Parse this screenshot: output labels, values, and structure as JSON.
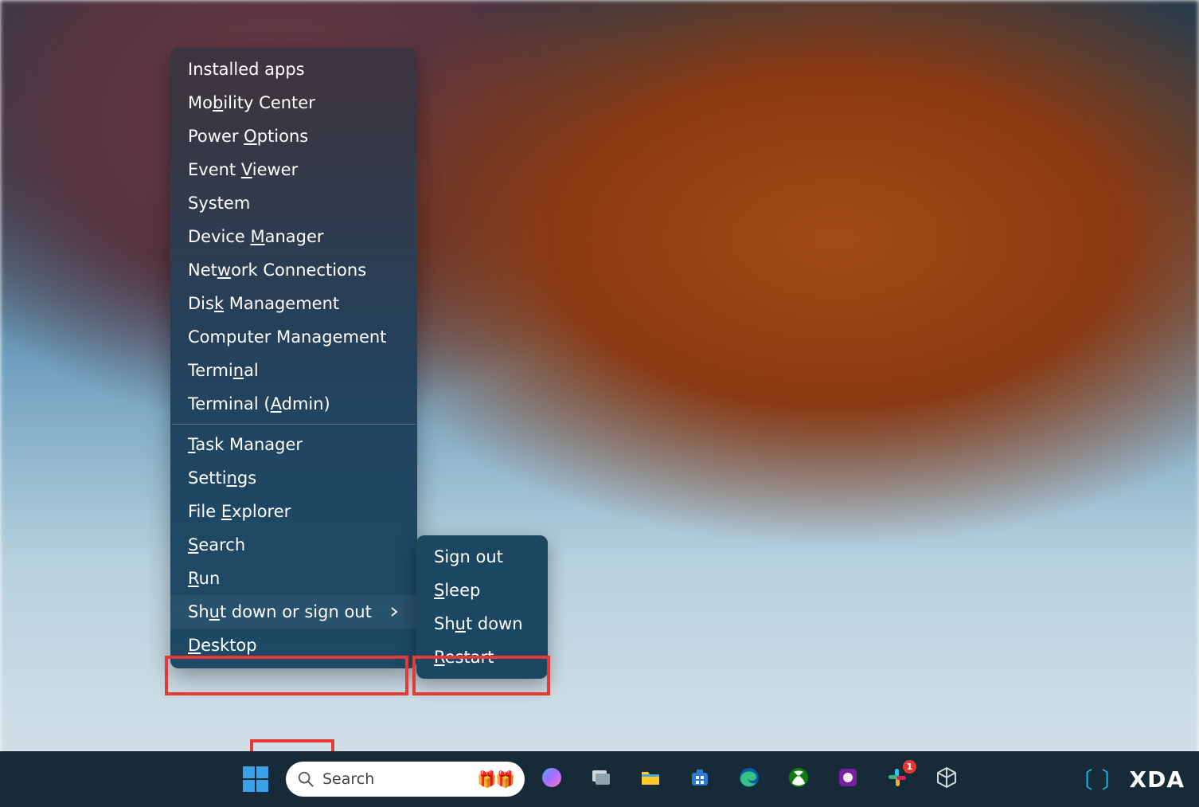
{
  "winx_menu": {
    "items_group1": [
      {
        "pre": "Installed apps",
        "u": "",
        "post": ""
      },
      {
        "pre": "Mo",
        "u": "b",
        "post": "ility Center"
      },
      {
        "pre": "Power ",
        "u": "O",
        "post": "ptions"
      },
      {
        "pre": "Event ",
        "u": "V",
        "post": "iewer"
      },
      {
        "pre": "S",
        "u": "",
        "post": "ystem"
      },
      {
        "pre": "Device ",
        "u": "M",
        "post": "anager"
      },
      {
        "pre": "Net",
        "u": "w",
        "post": "ork Connections"
      },
      {
        "pre": "Dis",
        "u": "k",
        "post": " Management"
      },
      {
        "pre": "Computer Management",
        "u": "",
        "post": ""
      },
      {
        "pre": "Termi",
        "u": "n",
        "post": "al"
      },
      {
        "pre": "Terminal (",
        "u": "A",
        "post": "dmin)"
      }
    ],
    "items_group2": [
      {
        "pre": "",
        "u": "T",
        "post": "ask Manager"
      },
      {
        "pre": "Setti",
        "u": "n",
        "post": "gs"
      },
      {
        "pre": "File ",
        "u": "E",
        "post": "xplorer"
      },
      {
        "pre": "",
        "u": "S",
        "post": "earch"
      },
      {
        "pre": "",
        "u": "R",
        "post": "un"
      }
    ],
    "shutdown_item": {
      "pre": "Sh",
      "u": "u",
      "post": "t down or sign out"
    },
    "items_group3": [
      {
        "pre": "",
        "u": "D",
        "post": "esktop"
      }
    ]
  },
  "power_submenu": {
    "items": [
      {
        "pre": "Sign out",
        "u": "",
        "post": ""
      },
      {
        "pre": "",
        "u": "S",
        "post": "leep"
      },
      {
        "pre": "Sh",
        "u": "u",
        "post": "t down"
      },
      {
        "pre": "",
        "u": "R",
        "post": "estart"
      }
    ]
  },
  "taskbar": {
    "search_placeholder": "Search",
    "search_emoji": "🎁🎁",
    "icons": [
      {
        "name": "copilot-icon"
      },
      {
        "name": "task-view-icon"
      },
      {
        "name": "file-explorer-icon"
      },
      {
        "name": "microsoft-store-icon"
      },
      {
        "name": "edge-icon"
      },
      {
        "name": "xbox-icon"
      },
      {
        "name": "app-purple-icon"
      },
      {
        "name": "slack-icon",
        "badge": "1"
      },
      {
        "name": "virtualbox-icon"
      }
    ]
  },
  "watermark": {
    "label": "XDA"
  }
}
